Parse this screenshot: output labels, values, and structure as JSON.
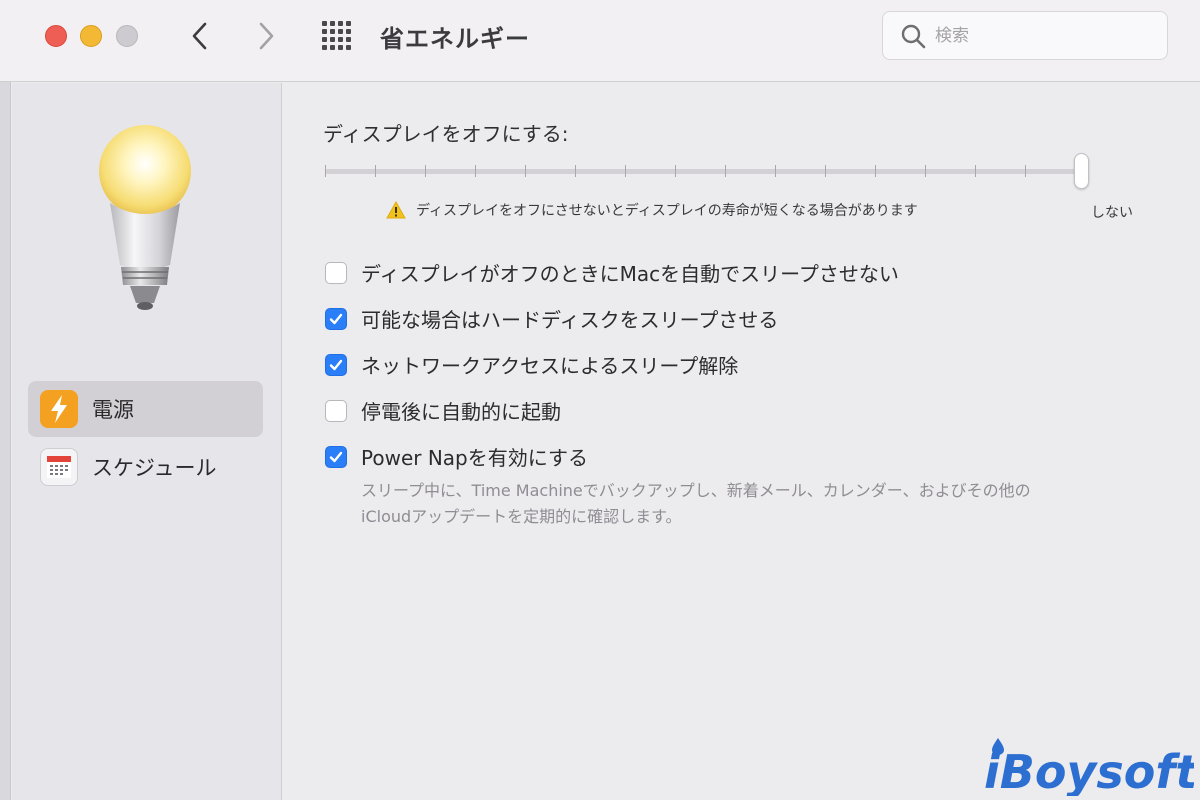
{
  "window": {
    "title": "省エネルギー",
    "search_placeholder": "検索"
  },
  "sidebar": {
    "items": [
      {
        "label": "電源",
        "icon": "lightning-icon",
        "selected": true
      },
      {
        "label": "スケジュール",
        "icon": "calendar-icon",
        "selected": false
      }
    ]
  },
  "main": {
    "slider_label": "ディスプレイをオフにする:",
    "slider_value": "しない",
    "warning": "ディスプレイをオフにさせないとディスプレイの寿命が短くなる場合があります",
    "options": [
      {
        "label": "ディスプレイがオフのときにMacを自動でスリープさせない",
        "checked": false
      },
      {
        "label": "可能な場合はハードディスクをスリープさせる",
        "checked": true
      },
      {
        "label": "ネットワークアクセスによるスリープ解除",
        "checked": true
      },
      {
        "label": "停電後に自動的に起動",
        "checked": false
      },
      {
        "label": "Power Napを有効にする",
        "checked": true
      }
    ],
    "power_nap_desc_1": "スリープ中に、Time Machineでバックアップし、新着メール、カレンダー、およびその他の",
    "power_nap_desc_2": "iCloudアップデートを定期的に確認します。"
  },
  "watermark": {
    "text": "iBoysoft"
  },
  "colors": {
    "accent": "#2a7ef7",
    "power_icon": "#f4a020",
    "warning": "#f1c21b"
  }
}
